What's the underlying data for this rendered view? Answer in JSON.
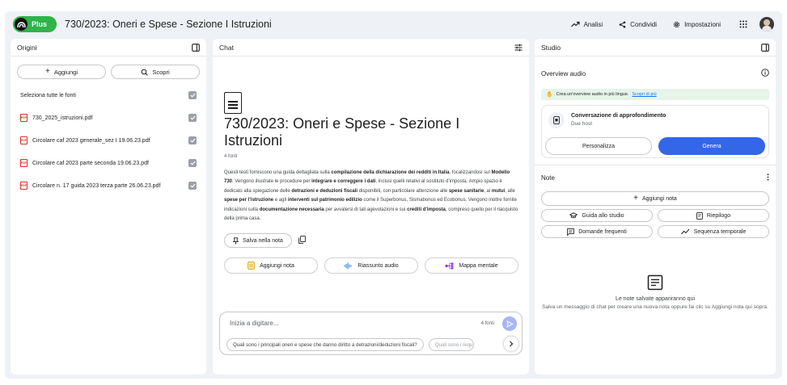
{
  "header": {
    "plan_badge": "Plus",
    "notebook_title": "730/2023: Oneri e Spese - Sezione I Istruzioni",
    "analytics_label": "Analisi",
    "share_label": "Condividi",
    "settings_label": "Impostazioni"
  },
  "sources": {
    "title": "Origini",
    "add_label": "Aggiungi",
    "discover_label": "Scopri",
    "select_all_label": "Seleziona tutte le fonti",
    "items": [
      {
        "name": "730_2025_istruzioni.pdf",
        "checked": true
      },
      {
        "name": "Circolare caf 2023 generale_sez I 19.06.23.pdf",
        "checked": true
      },
      {
        "name": "Circolare caf 2023 parte seconda 19.06.23.pdf",
        "checked": true
      },
      {
        "name": "Circolare n. 17 guida 2023 terza parte 26.06.23.pdf",
        "checked": true
      }
    ]
  },
  "chat": {
    "title": "Chat",
    "notebook_heading": "730/2023: Oneri e Spese - Sezione I Istruzioni",
    "source_count": "4 fonti",
    "summary": [
      {
        "t": "Questi testi forniscono una guida dettagliata sulla ",
        "b": false
      },
      {
        "t": "compilazione della dichiarazione dei redditi in Italia",
        "b": true
      },
      {
        "t": ", focalizzandosi sul ",
        "b": false
      },
      {
        "t": "Modello 730",
        "b": true
      },
      {
        "t": ". Vengono illustrate le procedure per ",
        "b": false
      },
      {
        "t": "integrare e correggere i dati",
        "b": true
      },
      {
        "t": ", inclusi quelli relativi al sostituto d'imposta. Ampio spazio è dedicato alla spiegazione delle ",
        "b": false
      },
      {
        "t": "detrazioni e deduzioni fiscali",
        "b": true
      },
      {
        "t": " disponibili, con particolare attenzione alle ",
        "b": false
      },
      {
        "t": "spese sanitarie",
        "b": true
      },
      {
        "t": ", ai ",
        "b": false
      },
      {
        "t": "mutui",
        "b": true
      },
      {
        "t": ", alle ",
        "b": false
      },
      {
        "t": "spese per l'istruzione",
        "b": true
      },
      {
        "t": " e agli ",
        "b": false
      },
      {
        "t": "interventi sul patrimonio edilizio",
        "b": true
      },
      {
        "t": " come il Superbonus, Sismabonus ed Ecobonus. Vengono inoltre fornite indicazioni sulla ",
        "b": false
      },
      {
        "t": "documentazione necessaria",
        "b": true
      },
      {
        "t": " per avvalersi di tali agevolazioni e sui ",
        "b": false
      },
      {
        "t": "crediti d'imposta",
        "b": true
      },
      {
        "t": ", compreso quello per il riacquisto della prima casa.",
        "b": false
      }
    ],
    "save_note_label": "Salva nella nota",
    "add_note_label": "Aggiungi nota",
    "audio_summary_label": "Riassunto audio",
    "mind_map_label": "Mappa mentale",
    "input_placeholder": "Inizia a digitare...",
    "input_source_count": "4 fonti",
    "suggestions": [
      "Quali sono i principali oneri e spese che danno diritto a detrazioni/deduzioni fiscali?",
      "Quali sono i requ"
    ]
  },
  "studio": {
    "title": "Studio",
    "overview_title": "Overview audio",
    "banner_text": "Crea un'overview audio in più lingue.",
    "banner_link": "Scopri di più",
    "conversation_title": "Conversazione di approfondimento",
    "conversation_subtitle": "Due host",
    "customize_label": "Personalizza",
    "generate_label": "Genera",
    "notes_title": "Note",
    "add_note_label": "Aggiungi nota",
    "study_guide_label": "Guida allo studio",
    "summary_label": "Riepilogo",
    "faq_label": "Domande frequenti",
    "timeline_label": "Sequenza temporale",
    "empty_title": "Le note salvate appariranno qui",
    "empty_subtitle": "Salva un messaggio di chat per creare una nuova nota oppure fai clic su Aggiungi nota qui sopra."
  },
  "colors": {
    "plus_badge": "#2fb34a",
    "primary_button": "#3367e8",
    "send_button": "#a8b5f5",
    "pdf_icon": "#d93025",
    "banner_bg": "#e6f4ea",
    "link": "#1a73e8"
  }
}
